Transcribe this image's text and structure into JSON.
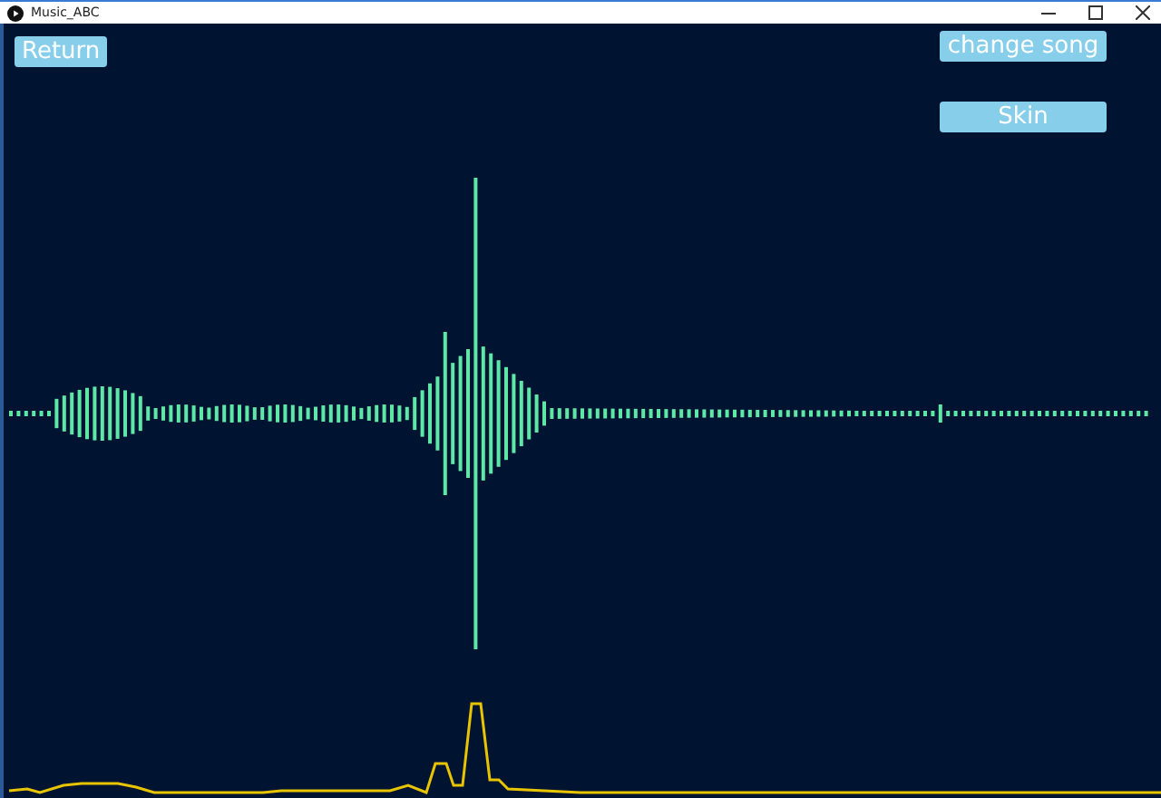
{
  "window": {
    "title": "Music_ABC"
  },
  "buttons": [
    {
      "label": "Return",
      "kind": "back"
    },
    {
      "label": "change song",
      "kind": "action"
    },
    {
      "label": "Skin",
      "kind": "action"
    }
  ]
}
